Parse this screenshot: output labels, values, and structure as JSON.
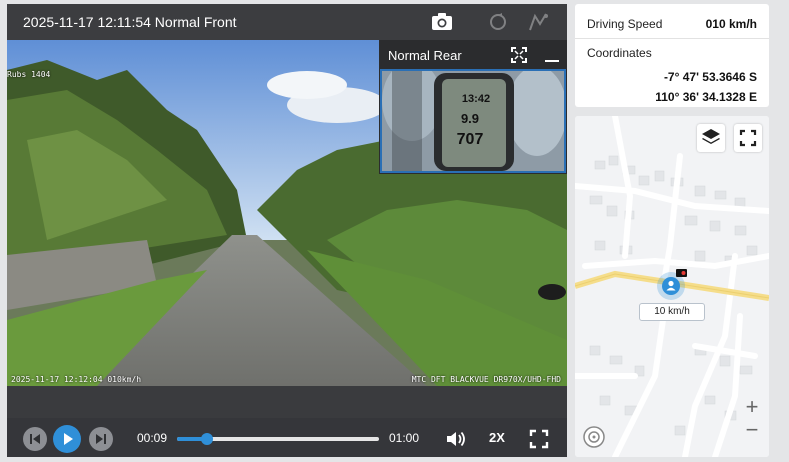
{
  "video": {
    "title": "2025-11-17 12:11:54 Normal Front",
    "osd_top_left": "Rubs 1404",
    "osd_bottom_left": "2025-11-17 12:12:04 010km/h",
    "osd_bottom_right": "MTC DFT BLACKVUE DR970X/UHD-FHD"
  },
  "rear": {
    "title": "Normal Rear",
    "gauge_time": "13:42",
    "gauge_speed": "9.9",
    "gauge_distance": "707"
  },
  "controls": {
    "current_time": "00:09",
    "total_time": "01:00",
    "speed_label": "2X",
    "progress": 0.15
  },
  "info": {
    "speed_label": "Driving Speed",
    "speed_value": "010 km/h",
    "coordinates_label": "Coordinates",
    "latitude": "-7° 47' 53.3646 S",
    "longitude": "110° 36' 34.1328 E"
  },
  "map": {
    "speed_tag": "10 km/h",
    "zoom_in": "+",
    "zoom_out": "−"
  },
  "colors": {
    "accent": "#2f8fd8",
    "panel": "#3a3b3e",
    "control_bar": "#35363a"
  },
  "icons": [
    "camera-icon",
    "sync-icon",
    "route-icon",
    "expand-icon",
    "minimize-icon",
    "prev-icon",
    "play-icon",
    "next-icon",
    "volume-icon",
    "fullscreen-icon",
    "layers-icon",
    "compass-icon",
    "vehicle-marker-icon"
  ]
}
